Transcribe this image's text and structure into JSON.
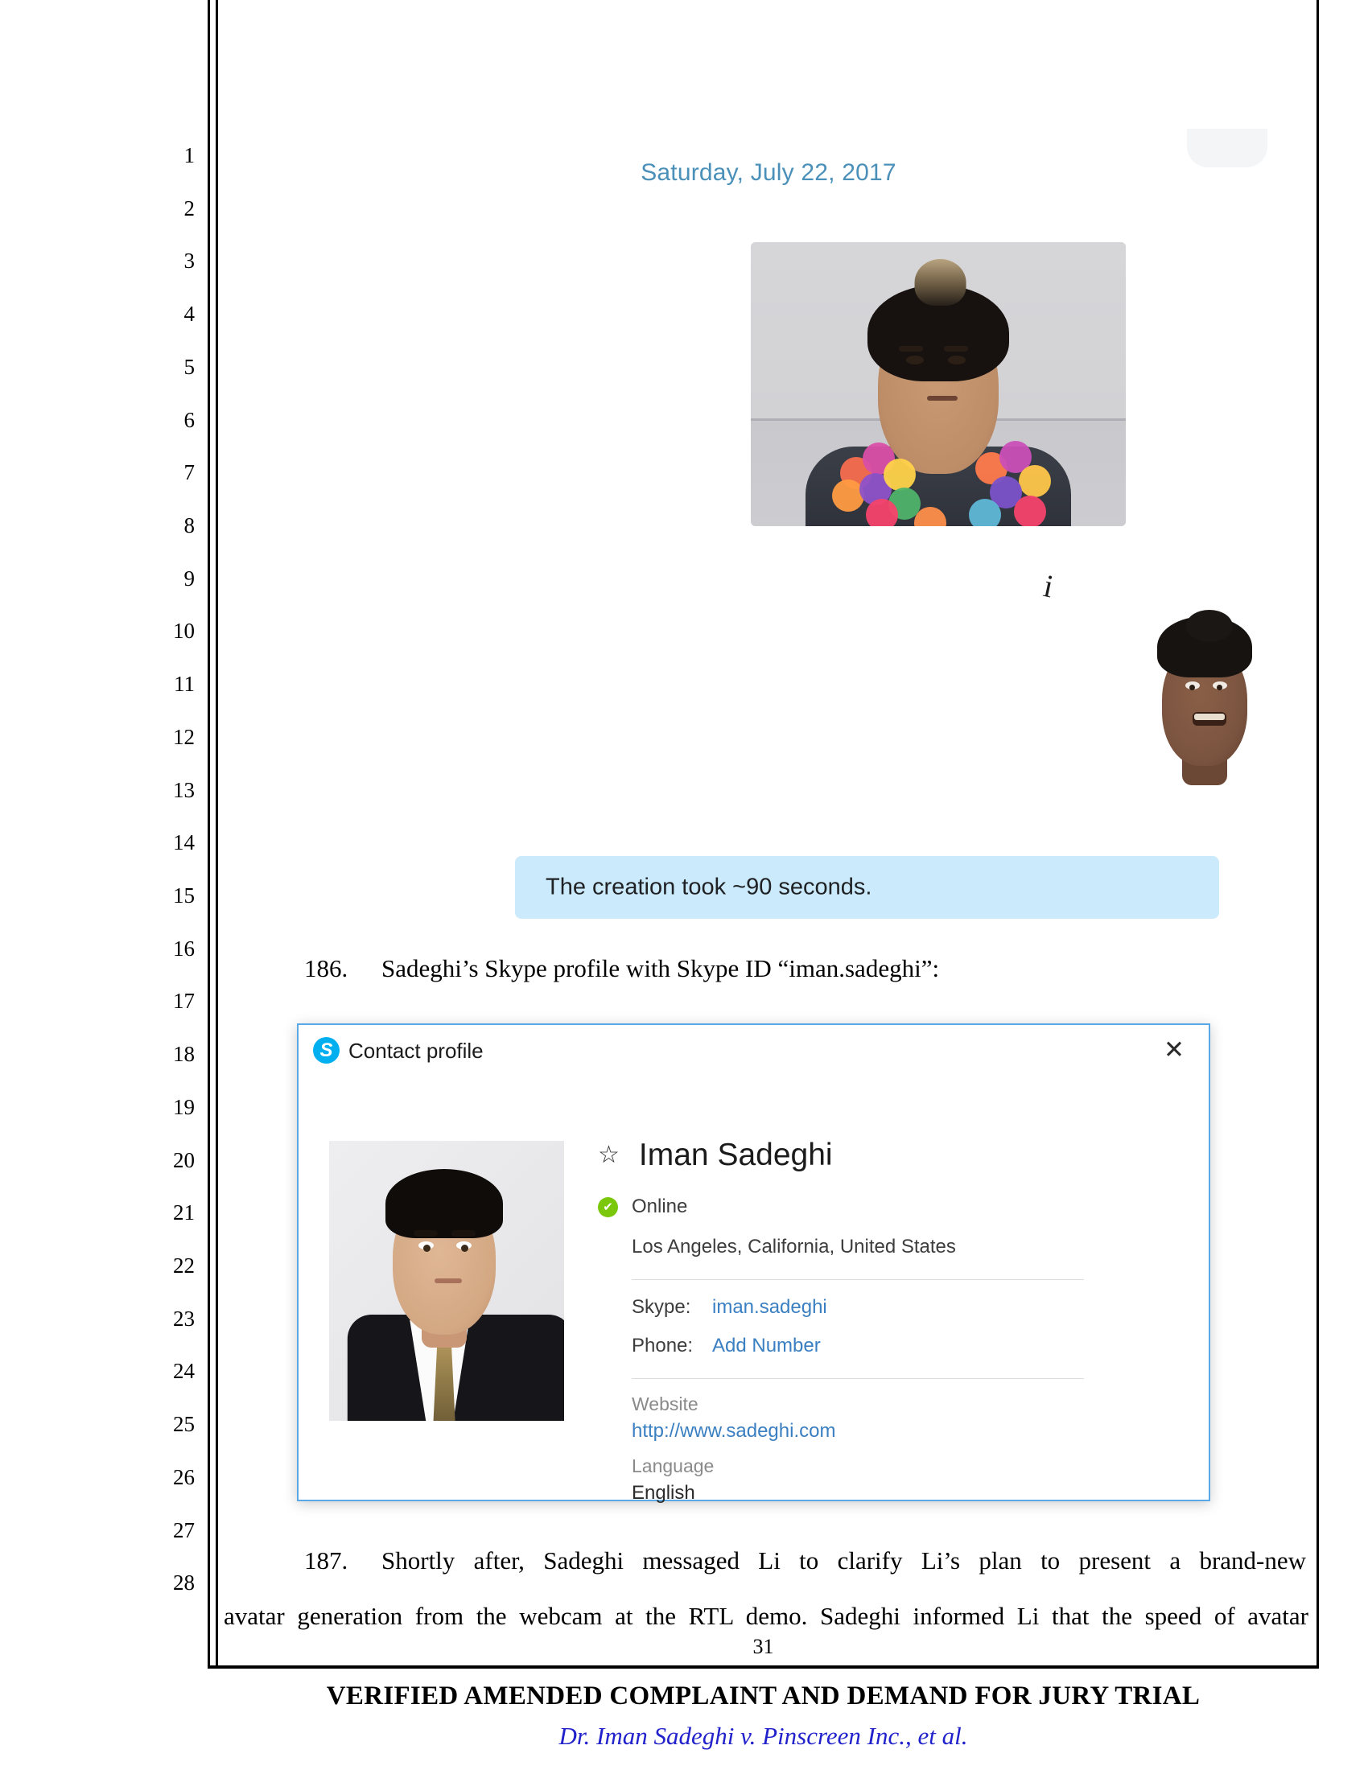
{
  "document": {
    "page_number": "31",
    "footer_title": "VERIFIED AMENDED COMPLAINT AND DEMAND FOR JURY TRIAL",
    "footer_case": "Dr. Iman Sadeghi v. Pinscreen Inc., et al.",
    "line_numbers": [
      "1",
      "2",
      "3",
      "4",
      "5",
      "6",
      "7",
      "8",
      "9",
      "10",
      "11",
      "12",
      "13",
      "14",
      "15",
      "16",
      "17",
      "18",
      "19",
      "20",
      "21",
      "22",
      "23",
      "24",
      "25",
      "26",
      "27",
      "28"
    ]
  },
  "exhibit_chat": {
    "date_header": "Saturday, July 22, 2017",
    "message_text": "The creation took ~90 seconds.",
    "photo_alt": "Photograph of man with top-knot hair wearing a floral lei",
    "avatar_alt": "3D generated avatar head"
  },
  "paragraphs": {
    "p186": {
      "number": "186.",
      "text": "Sadeghi’s Skype profile with Skype ID “iman.sadeghi”:"
    },
    "p187": {
      "number": "187.",
      "line1": "Shortly after, Sadeghi messaged Li to clarify Li’s plan to present a brand-new",
      "line2": "avatar generation from the webcam at the RTL demo. Sadeghi informed Li that the speed of avatar"
    }
  },
  "skype_dialog": {
    "title": "Contact profile",
    "logo_letter": "S",
    "close_label": "✕",
    "star_glyph": "☆",
    "contact_name": "Iman Sadeghi",
    "status_check": "✔",
    "status": "Online",
    "location": "Los Angeles, California, United States",
    "fields": [
      {
        "key": "Skype:",
        "value": "iman.sadeghi"
      },
      {
        "key": "Phone:",
        "value": "Add Number"
      }
    ],
    "website_label": "Website",
    "website_value": "http://www.sadeghi.com",
    "language_label": "Language",
    "language_value": "English"
  },
  "colors": {
    "skype_blue": "#00aff0",
    "link_blue": "#3a7fc1",
    "bubble_blue": "#cbeafb",
    "date_blue": "#4a90b8",
    "online_green": "#7ac70c",
    "case_blue": "#2222cc"
  }
}
